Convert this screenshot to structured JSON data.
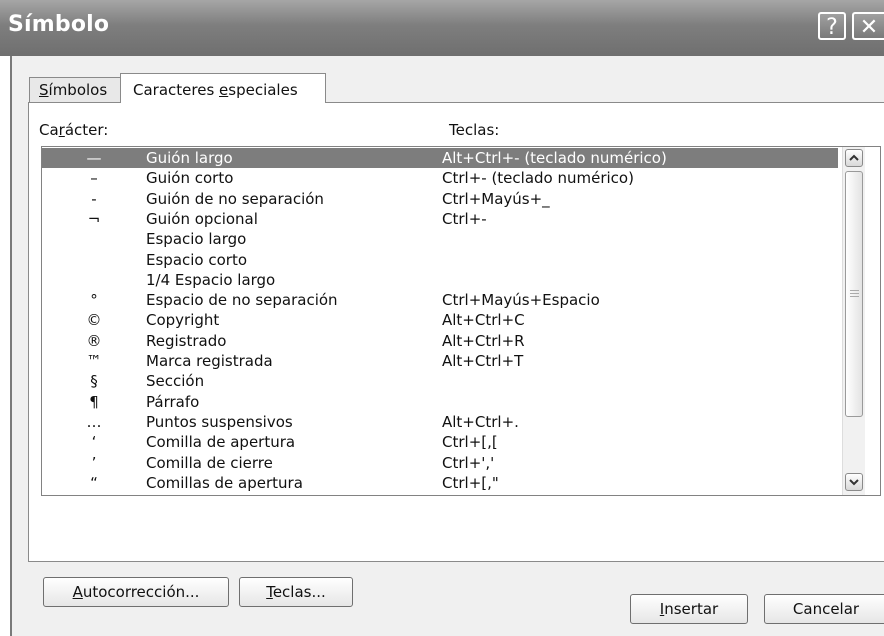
{
  "window": {
    "title": "Símbolo",
    "help_label": "?",
    "close_label": "✕"
  },
  "tabs": [
    {
      "label_u": "S",
      "label_rest": "ímbolos"
    },
    {
      "label_pre": "Caracteres ",
      "label_u": "e",
      "label_rest": "speciales"
    }
  ],
  "columns": {
    "character_pre": "Ca",
    "character_u": "r",
    "character_rest": "ácter:",
    "keys": "Teclas:"
  },
  "rows": [
    {
      "char": "—",
      "name": "Guión largo",
      "keys": "Alt+Ctrl+- (teclado numérico)",
      "selected": true
    },
    {
      "char": "–",
      "name": "Guión corto",
      "keys": "Ctrl+- (teclado numérico)"
    },
    {
      "char": "-",
      "name": "Guión de no separación",
      "keys": "Ctrl+Mayús+_"
    },
    {
      "char": "¬",
      "name": "Guión opcional",
      "keys": "Ctrl+-"
    },
    {
      "char": "",
      "name": "Espacio largo",
      "keys": ""
    },
    {
      "char": "",
      "name": "Espacio corto",
      "keys": ""
    },
    {
      "char": "",
      "name": "1/4 Espacio largo",
      "keys": ""
    },
    {
      "char": "°",
      "name": "Espacio de no separación",
      "keys": "Ctrl+Mayús+Espacio"
    },
    {
      "char": "©",
      "name": "Copyright",
      "keys": "Alt+Ctrl+C"
    },
    {
      "char": "®",
      "name": "Registrado",
      "keys": "Alt+Ctrl+R"
    },
    {
      "char": "™",
      "name": "Marca registrada",
      "keys": "Alt+Ctrl+T"
    },
    {
      "char": "§",
      "name": "Sección",
      "keys": ""
    },
    {
      "char": "¶",
      "name": "Párrafo",
      "keys": ""
    },
    {
      "char": "…",
      "name": "Puntos suspensivos",
      "keys": "Alt+Ctrl+."
    },
    {
      "char": "‘",
      "name": "Comilla de apertura",
      "keys": "Ctrl+[,["
    },
    {
      "char": "’",
      "name": "Comilla de cierre",
      "keys": "Ctrl+',' "
    },
    {
      "char": "“",
      "name": "Comillas de apertura",
      "keys": "Ctrl+[,\""
    }
  ],
  "buttons": {
    "autocorreccion_u": "A",
    "autocorreccion_rest": "utocorrección...",
    "teclas_u": "T",
    "teclas_rest": "eclas...",
    "insertar_u": "I",
    "insertar_rest": "nsertar",
    "cancelar": "Cancelar"
  },
  "icons": {
    "scroll_up": "chevron-up-icon",
    "scroll_down": "chevron-down-icon",
    "grip": "scroll-grip-icon"
  }
}
